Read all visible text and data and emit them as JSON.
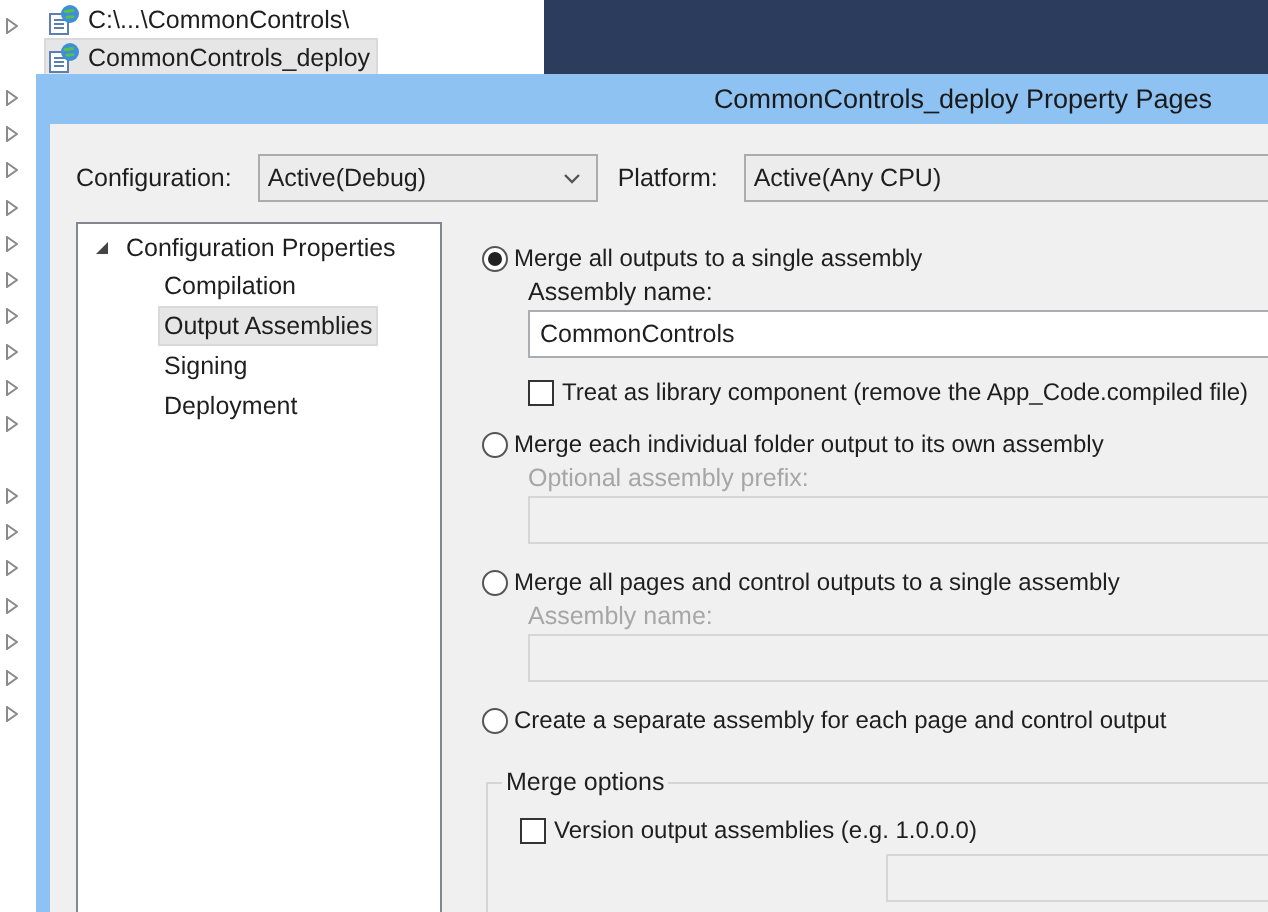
{
  "solution_explorer": {
    "items": [
      {
        "label": "C:\\...\\CommonControls\\",
        "selected": false
      },
      {
        "label": "CommonControls_deploy",
        "selected": true
      }
    ]
  },
  "dialog": {
    "title": "CommonControls_deploy Property Pages",
    "configuration": {
      "label": "Configuration:",
      "value": "Active(Debug)"
    },
    "platform": {
      "label": "Platform:",
      "value": "Active(Any CPU)"
    },
    "tree": {
      "label": "Configuration Properties",
      "expanded": true,
      "children": [
        {
          "label": "Compilation",
          "selected": false
        },
        {
          "label": "Output Assemblies",
          "selected": true
        },
        {
          "label": "Signing",
          "selected": false
        },
        {
          "label": "Deployment",
          "selected": false
        }
      ]
    },
    "options": [
      {
        "label": "Merge all outputs to a single assembly",
        "selected": true,
        "field": {
          "label": "Assembly name:",
          "value": "CommonControls",
          "disabled": false
        },
        "checkbox": {
          "label": "Treat as library component (remove the App_Code.compiled file)",
          "checked": false
        }
      },
      {
        "label": "Merge each individual folder output to its own assembly",
        "selected": false,
        "field": {
          "label": "Optional assembly prefix:",
          "disabled": true
        }
      },
      {
        "label": "Merge all pages and control outputs to a single assembly",
        "selected": false,
        "field": {
          "label": "Assembly name:",
          "disabled": true
        }
      },
      {
        "label": "Create a separate assembly for each page and control output",
        "selected": false
      }
    ],
    "merge_options": {
      "title": "Merge options",
      "checkbox": {
        "label": "Version output assemblies (e.g. 1.0.0.0)",
        "checked": false
      }
    }
  }
}
